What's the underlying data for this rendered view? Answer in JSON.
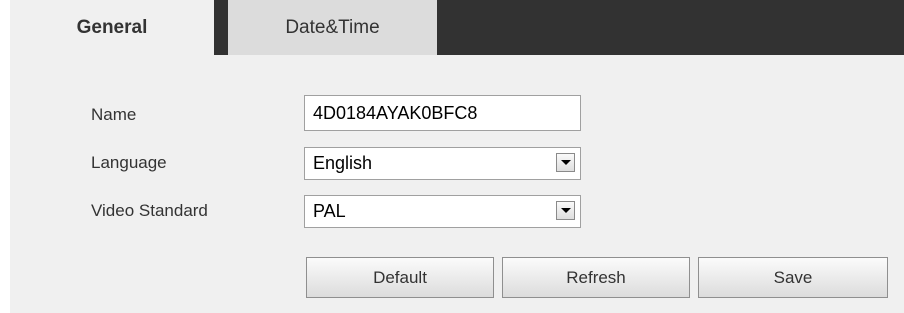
{
  "tabs": {
    "general": "General",
    "datetime": "Date&Time"
  },
  "form": {
    "name_label": "Name",
    "name_value": "4D0184AYAK0BFC8",
    "language_label": "Language",
    "language_value": "English",
    "video_standard_label": "Video Standard",
    "video_standard_value": "PAL"
  },
  "buttons": {
    "default": "Default",
    "refresh": "Refresh",
    "save": "Save"
  },
  "colors": {
    "tabbar_dark": "#323232",
    "panel_bg": "#f0f0f0",
    "inactive_tab": "#dcdcdc"
  }
}
